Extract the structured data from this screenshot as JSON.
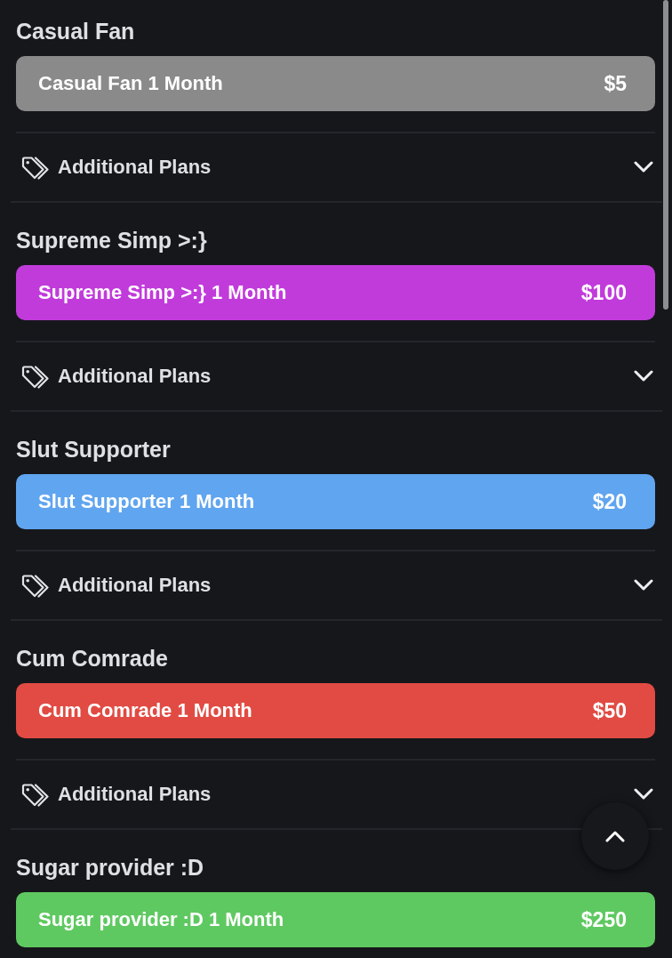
{
  "tiers": [
    {
      "title": "Casual Fan",
      "plan_label": "Casual Fan 1 Month",
      "price": "$5",
      "color": "#8a8a8a",
      "additional_plans": {
        "label": "Additional Plans",
        "expanded": false
      }
    },
    {
      "title": "Supreme Simp >:}",
      "plan_label": "Supreme Simp >:} 1 Month",
      "price": "$100",
      "color": "#c13bdb",
      "additional_plans": {
        "label": "Additional Plans",
        "expanded": false
      }
    },
    {
      "title": "Slut Supporter",
      "plan_label": "Slut Supporter 1 Month",
      "price": "$20",
      "color": "#60a5ef",
      "additional_plans": {
        "label": "Additional Plans",
        "expanded": false
      }
    },
    {
      "title": "Cum Comrade",
      "plan_label": "Cum Comrade 1 Month",
      "price": "$50",
      "color": "#e14b43",
      "additional_plans": {
        "label": "Additional Plans",
        "expanded": false
      }
    },
    {
      "title": "Sugar provider :D",
      "plan_label": "Sugar provider :D 1 Month",
      "price": "$250",
      "color": "#5fc961"
    }
  ]
}
